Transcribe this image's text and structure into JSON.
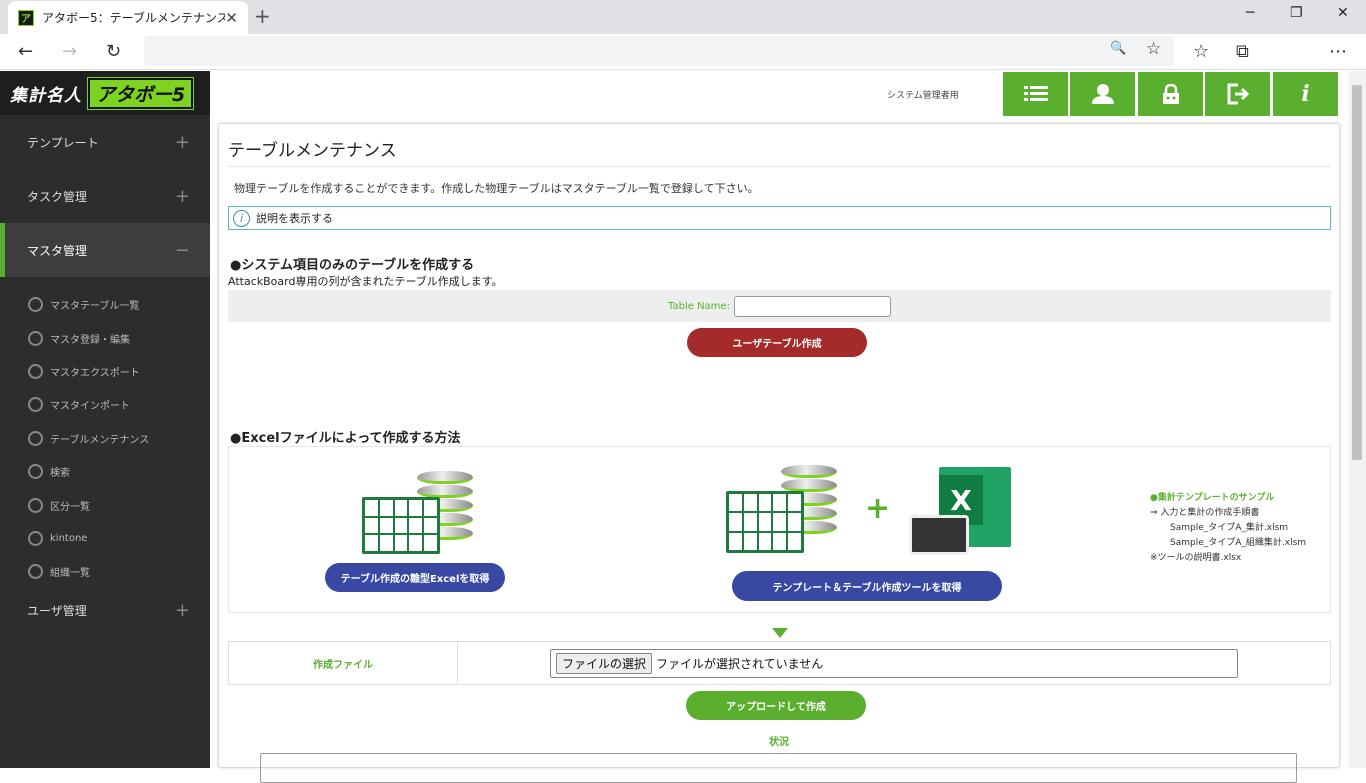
{
  "browser": {
    "tab_title": "アタボー5：テーブルメンテナンス",
    "tab_close": "✕",
    "new_tab": "+",
    "min": "─",
    "restore": "❐",
    "close": "✕",
    "back": "←",
    "forward": "→",
    "reload": "↻",
    "zoom_icon": "🔍",
    "fav_add": "☆",
    "favorites": "☆",
    "collections": "⧉",
    "menu": "⋯",
    "favicon": "ア"
  },
  "logo": {
    "part1": "集計名人",
    "part2": "アタボー5"
  },
  "sidebar": {
    "sections": [
      {
        "label": "テンプレート",
        "toggle": "+"
      },
      {
        "label": "タスク管理",
        "toggle": "+"
      },
      {
        "label": "マスタ管理",
        "toggle": "−"
      },
      {
        "label": "ユーザ管理",
        "toggle": "+"
      }
    ],
    "master_items": [
      "マスタテーブル一覧",
      "マスタ登録・編集",
      "マスタエクスポート",
      "マスタインポート",
      "テーブルメンテナンス",
      "検索",
      "区分一覧",
      "kintone",
      "組織一覧"
    ]
  },
  "header": {
    "role": "システム管理者用",
    "info_icon": "i"
  },
  "page": {
    "title": "テーブルメンテナンス",
    "description": "物理テーブルを作成することができます。作成した物理テーブルはマスタテーブル一覧で登録して下さい。",
    "info_icon": "i",
    "info_label": "説明を表示する",
    "section1": {
      "heading": "●システム項目のみのテーブルを作成する",
      "sub": "AttackBoard専用の列が含まれたテーブル作成します。",
      "table_name_label": "Table Name:",
      "table_name_value": "",
      "create_button": "ユーザテーブル作成"
    },
    "section2": {
      "heading": "●Excelファイルによって作成する方法",
      "template_button": "テーブル作成の雛型Excelを取得",
      "tool_button": "テンプレート＆テーブル作成ツールを取得",
      "plus": "+",
      "excel_x": "X",
      "sample_heading": "●集計テンプレートのサンプル",
      "sample_lines": [
        "⇒ 入力と集計の作成手順書",
        "Sample_タイプA_集計.xlsm",
        "Sample_タイプA_組織集計.xlsm",
        "※ツールの説明書.xlsx"
      ]
    },
    "file_label": "作成ファイル",
    "file_button": "ファイルの選択",
    "file_status": "ファイルが選択されていません",
    "upload_button": "アップロードして作成",
    "status_label": "状況"
  },
  "colors": {
    "green": "#5aaf2e",
    "red": "#a52a2a",
    "blue": "#3949a3",
    "sidebar": "#2d2d2d"
  }
}
